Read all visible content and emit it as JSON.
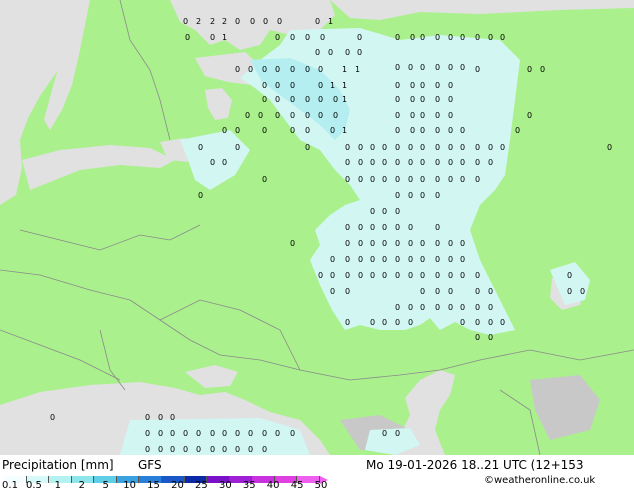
{
  "header": {
    "title": "Precipitation [mm]",
    "model": "GFS",
    "valid_time": "Mo 19-01-2026 18..21 UTC (12+153",
    "credit": "©weatheronline.co.uk"
  },
  "legend": {
    "labels": [
      "0.1",
      "0.5",
      "1",
      "2",
      "5",
      "10",
      "15",
      "20",
      "25",
      "30",
      "35",
      "40",
      "45",
      "50"
    ],
    "colors": [
      "#f4fefe",
      "#d6fafa",
      "#b4f2f2",
      "#8ce6ec",
      "#5ecfe6",
      "#3aa2e0",
      "#2a7fd8",
      "#1a58c8",
      "#0c2aa8",
      "#7a10c8",
      "#a020d8",
      "#c830e0",
      "#e040e0",
      "#f060f0"
    ]
  },
  "map": {
    "colors": {
      "land": "#aaf08c",
      "sea": "#e1e1e1",
      "precip_light": "#d2f7f3",
      "precip_medium": "#b4eef0",
      "border": "#8a8a8a",
      "mountain": "#c8c8c8"
    },
    "digit_clusters": [
      {
        "symbol": "0",
        "count": 150,
        "region": "central-russia"
      },
      {
        "symbol": "1",
        "count": 14,
        "region": "northwest-russia"
      },
      {
        "symbol": "2",
        "count": 3,
        "region": "white-sea"
      },
      {
        "symbol": "0",
        "count": 30,
        "region": "black-sea-coast"
      }
    ]
  }
}
